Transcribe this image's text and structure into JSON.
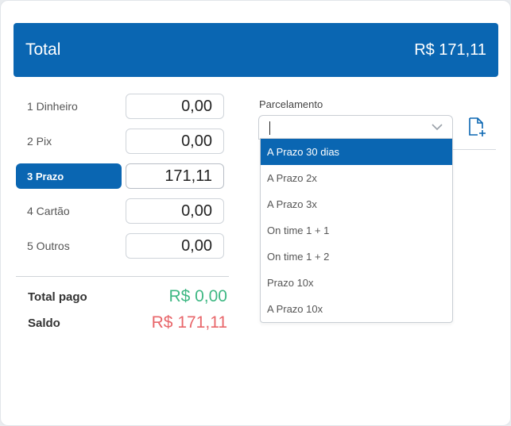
{
  "header": {
    "title": "Total",
    "amount": "R$ 171,11"
  },
  "payments": [
    {
      "label": "1 Dinheiro",
      "value": "0,00"
    },
    {
      "label": "2 Pix",
      "value": "0,00"
    },
    {
      "label": "3 Prazo",
      "value": "171,11"
    },
    {
      "label": "4 Cartão",
      "value": "0,00"
    },
    {
      "label": "5 Outros",
      "value": "0,00"
    }
  ],
  "summary": {
    "paid_label": "Total pago",
    "paid_value": "R$ 0,00",
    "balance_label": "Saldo",
    "balance_value": "R$ 171,11"
  },
  "parcelamento": {
    "label": "Parcelamento",
    "value": "",
    "options": [
      "A Prazo 30 dias",
      "A Prazo 2x",
      "A Prazo 3x",
      "On time 1 + 1",
      "On time 1 + 2",
      "Prazo 10x",
      "A Prazo 10x"
    ]
  },
  "colors": {
    "primary": "#0a66b2",
    "positive": "#3fb884",
    "negative": "#e8666a"
  },
  "icons": {
    "new_document": "file-plus-icon",
    "dropdown": "chevron-down-icon"
  }
}
